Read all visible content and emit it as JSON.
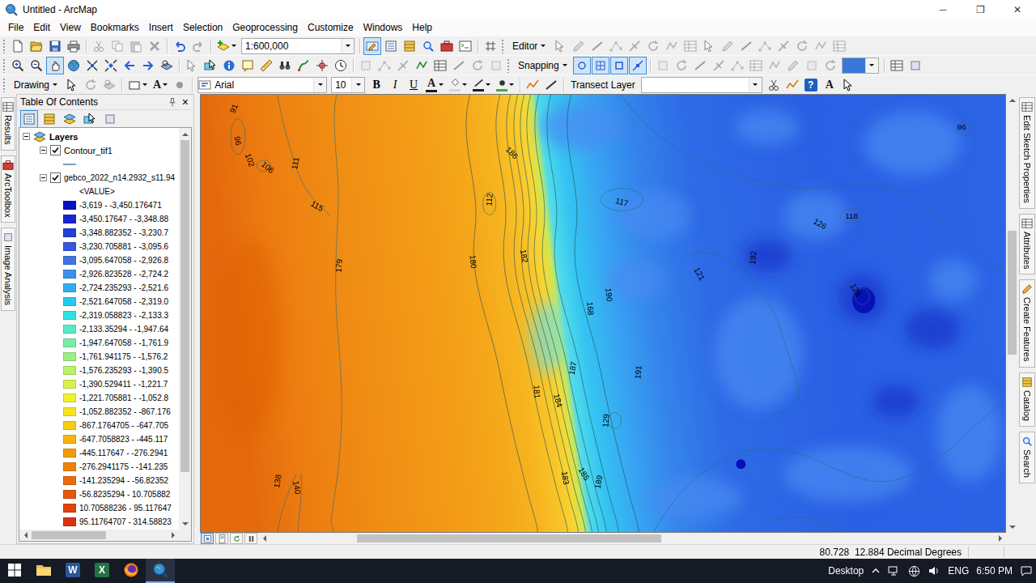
{
  "window": {
    "title": "Untitled - ArcMap",
    "controls": [
      "─",
      "❐",
      "✕"
    ]
  },
  "menu": [
    "File",
    "Edit",
    "View",
    "Bookmarks",
    "Insert",
    "Selection",
    "Geoprocessing",
    "Customize",
    "Windows",
    "Help"
  ],
  "standard_toolbar": {
    "file": [
      {
        "disabled": false,
        "pressed": false
      },
      {
        "disabled": false,
        "pressed": false
      },
      {
        "disabled": false,
        "pressed": false
      },
      {
        "disabled": false,
        "pressed": false
      }
    ],
    "clipboard": [
      {
        "disabled": true,
        "pressed": false
      },
      {
        "disabled": true,
        "pressed": false
      },
      {
        "disabled": true,
        "pressed": false
      },
      {
        "disabled": true,
        "pressed": false
      }
    ],
    "history": [
      {
        "disabled": false,
        "pressed": false
      },
      {
        "disabled": true,
        "pressed": false
      }
    ],
    "add_data": [
      {
        "disabled": false,
        "pressed": false
      }
    ],
    "scale": "1:600,000",
    "windows": [
      {
        "disabled": false,
        "pressed": true
      },
      {
        "disabled": false,
        "pressed": false
      },
      {
        "disabled": false,
        "pressed": false
      },
      {
        "disabled": false,
        "pressed": false
      },
      {
        "disabled": false,
        "pressed": false
      },
      {
        "disabled": false,
        "pressed": false
      }
    ],
    "extras": [
      {
        "disabled": false,
        "pressed": false
      }
    ],
    "editor_menu": "Editor",
    "edit_tools": [
      {
        "disabled": true,
        "pressed": false
      },
      {
        "disabled": true,
        "pressed": false
      },
      {
        "disabled": true,
        "pressed": false
      },
      {
        "disabled": true,
        "pressed": false
      },
      {
        "disabled": true,
        "pressed": false
      },
      {
        "disabled": true,
        "pressed": false
      },
      {
        "disabled": true,
        "pressed": false
      },
      {
        "disabled": true,
        "pressed": false
      },
      {
        "disabled": true,
        "pressed": false
      },
      {
        "disabled": true,
        "pressed": false
      },
      {
        "disabled": true,
        "pressed": false
      },
      {
        "disabled": true,
        "pressed": false
      },
      {
        "disabled": true,
        "pressed": false
      },
      {
        "disabled": true,
        "pressed": false
      },
      {
        "disabled": true,
        "pressed": false
      },
      {
        "disabled": true,
        "pressed": false
      }
    ]
  },
  "tools_toolbar": {
    "navigation": [
      {
        "disabled": false,
        "pressed": false
      },
      {
        "disabled": false,
        "pressed": false
      },
      {
        "disabled": false,
        "pressed": true
      },
      {
        "disabled": false,
        "pressed": false
      },
      {
        "disabled": false,
        "pressed": false
      },
      {
        "disabled": false,
        "pressed": false
      },
      {
        "disabled": false,
        "pressed": false
      },
      {
        "disabled": false,
        "pressed": false
      },
      {
        "disabled": false,
        "pressed": false
      }
    ],
    "query": [
      {
        "disabled": true,
        "pressed": false
      },
      {
        "disabled": false,
        "pressed": false
      },
      {
        "disabled": false,
        "pressed": false
      },
      {
        "disabled": false,
        "pressed": false
      },
      {
        "disabled": false,
        "pressed": false
      },
      {
        "disabled": false,
        "pressed": false
      },
      {
        "disabled": false,
        "pressed": false
      },
      {
        "disabled": false,
        "pressed": false
      },
      {
        "disabled": false,
        "pressed": false
      }
    ],
    "analysis": [
      {
        "disabled": true,
        "pressed": false
      },
      {
        "disabled": true,
        "pressed": false
      },
      {
        "disabled": true,
        "pressed": false
      },
      {
        "disabled": false,
        "pressed": false
      },
      {
        "disabled": false,
        "pressed": false
      },
      {
        "disabled": true,
        "pressed": false
      },
      {
        "disabled": true,
        "pressed": false
      },
      {
        "disabled": true,
        "pressed": false
      }
    ],
    "snapping_menu": "Snapping",
    "snapping": [
      {
        "disabled": false,
        "pressed": true
      },
      {
        "disabled": false,
        "pressed": true
      },
      {
        "disabled": false,
        "pressed": true
      },
      {
        "disabled": false,
        "pressed": true
      }
    ],
    "georeferencing": [
      {
        "disabled": true,
        "pressed": false
      },
      {
        "disabled": true,
        "pressed": false
      },
      {
        "disabled": true,
        "pressed": false
      },
      {
        "disabled": true,
        "pressed": false
      },
      {
        "disabled": true,
        "pressed": false
      },
      {
        "disabled": true,
        "pressed": false
      },
      {
        "disabled": true,
        "pressed": false
      },
      {
        "disabled": true,
        "pressed": false
      },
      {
        "disabled": true,
        "pressed": false
      },
      {
        "disabled": true,
        "pressed": false
      }
    ],
    "georef_field": {
      "highlighted": true
    },
    "end": [
      {
        "disabled": false,
        "pressed": false
      },
      {
        "disabled": false,
        "pressed": false
      }
    ]
  },
  "drawing_toolbar": {
    "menu": "Drawing",
    "select": [
      {
        "disabled": false,
        "pressed": false
      },
      {
        "disabled": true,
        "pressed": false
      },
      {
        "disabled": true,
        "pressed": false
      }
    ],
    "shape": [
      {
        "disabled": false,
        "pressed": false
      }
    ],
    "text_tool": {
      "label": "A",
      "disabled": false,
      "pressed": false
    },
    "marker": [
      {
        "disabled": true,
        "pressed": false
      }
    ],
    "font": "Arial",
    "size": "10",
    "styles": [
      {
        "label": "B",
        "pressed": false
      },
      {
        "label": "I",
        "pressed": false
      },
      {
        "label": "U",
        "pressed": false
      }
    ],
    "colors": [
      {
        "kind": "text",
        "label": "A",
        "color": "#1a1a1a"
      },
      {
        "kind": "fill",
        "color": "#d6d6d6"
      },
      {
        "kind": "line",
        "color": "#202020"
      },
      {
        "kind": "marker",
        "color": "#3fae49"
      }
    ],
    "extras": [
      {
        "disabled": false,
        "pressed": false
      },
      {
        "disabled": false,
        "pressed": false
      }
    ],
    "transect_label": "Transect Layer",
    "tail": [
      {
        "disabled": false,
        "pressed": false
      },
      {
        "disabled": false,
        "pressed": false
      }
    ],
    "help": "?",
    "text_button": "A",
    "last": [
      {
        "disabled": false,
        "pressed": false
      }
    ]
  },
  "left_tabs": [
    "Results",
    "ArcToolbox",
    "Image Analysis"
  ],
  "right_tabs": [
    "Edit Sketch Properties",
    "Attributes",
    "Create Features",
    "Catalog",
    "Search"
  ],
  "toc": {
    "title": "Table Of Contents",
    "close": "×",
    "toolbar": [
      {
        "disabled": false,
        "pressed": true
      },
      {
        "disabled": false,
        "pressed": false
      },
      {
        "disabled": false,
        "pressed": false
      },
      {
        "disabled": false,
        "pressed": false
      },
      {
        "disabled": false,
        "pressed": false
      }
    ],
    "root": {
      "label": "Layers",
      "expanded": true
    },
    "contour_layer": {
      "label": "Contour_tif1",
      "checked": true,
      "expanded": true,
      "color": "#4f7fa8"
    },
    "raster_layer": {
      "label": "gebco_2022_n14.2932_s11.94",
      "checked": true,
      "expanded": true,
      "field": "<VALUE>",
      "classes": [
        {
          "label": "-3,619 - -3,450.176471",
          "color": "#0b0fc4"
        },
        {
          "label": "-3,450.17647 - -3,348.88",
          "color": "#1626d2"
        },
        {
          "label": "-3,348.882352 - -3,230.7",
          "color": "#2540d8"
        },
        {
          "label": "-3,230.705881 - -3,095.6",
          "color": "#3458dc"
        },
        {
          "label": "-3,095.647058 - -2,926.8",
          "color": "#3f74e2"
        },
        {
          "label": "-2,926.823528 - -2,724.2",
          "color": "#3c90e8"
        },
        {
          "label": "-2,724.235293 - -2,521.6",
          "color": "#32aeec"
        },
        {
          "label": "-2,521.647058 - -2,319.0",
          "color": "#26caf0"
        },
        {
          "label": "-2,319.058823 - -2,133.3",
          "color": "#2ee2e4"
        },
        {
          "label": "-2,133.35294 - -1,947.64",
          "color": "#56eac6"
        },
        {
          "label": "-1,947.647058 - -1,761.9",
          "color": "#7aeca6"
        },
        {
          "label": "-1,761.941175 - -1,576.2",
          "color": "#9cee86"
        },
        {
          "label": "-1,576.235293 - -1,390.5",
          "color": "#bcf066"
        },
        {
          "label": "-1,390.529411 - -1,221.7",
          "color": "#d8f04a"
        },
        {
          "label": "-1,221.705881 - -1,052.8",
          "color": "#eef030"
        },
        {
          "label": "-1,052.882352 - -867.176",
          "color": "#f8e41c"
        },
        {
          "label": "-867.1764705 - -647.705",
          "color": "#f8cc12"
        },
        {
          "label": "-647.7058823 - -445.117",
          "color": "#f6b40e"
        },
        {
          "label": "-445.117647 - -276.2941",
          "color": "#f29c0c"
        },
        {
          "label": "-276.2941175 - -141.235",
          "color": "#ee840c"
        },
        {
          "label": "-141.235294 - -56.82352",
          "color": "#ea6c0c"
        },
        {
          "label": "-56.8235294 - 10.705882",
          "color": "#e6560c"
        },
        {
          "label": "10.70588236 - 95.117647",
          "color": "#e2420e"
        },
        {
          "label": "95.11764707 - 314.58823",
          "color": "#d83412"
        }
      ]
    },
    "vscroll": {
      "level": 0,
      "thumb": 0.88
    },
    "hscroll": {
      "level": 0,
      "thumb": 0.55
    }
  },
  "map": {
    "contour_labels": [
      "91",
      "96",
      "102",
      "106",
      "111",
      "115",
      "179",
      "180",
      "182",
      "186",
      "112",
      "117",
      "126",
      "118",
      "121",
      "192",
      "190",
      "168",
      "191",
      "187",
      "181",
      "184",
      "129",
      "183",
      "185",
      "189",
      "138",
      "140",
      "96",
      "128"
    ],
    "vscroll": {
      "level": 0.3,
      "thumb": 0.3
    },
    "hscroll": {
      "level": 0.12,
      "thumb": 0.42
    },
    "view_buttons": [
      {
        "disabled": false,
        "pressed": true
      },
      {
        "disabled": false,
        "pressed": false
      }
    ],
    "refresh_buttons": [
      {
        "disabled": false,
        "pressed": false
      },
      {
        "disabled": false,
        "pressed": false
      }
    ]
  },
  "status": {
    "text": "80.728  12.884 Decimal Degrees"
  },
  "taskbar": {
    "apps": [
      {
        "kind": "explorer",
        "active": false
      },
      {
        "kind": "word",
        "letter": "W",
        "active": false
      },
      {
        "kind": "excel",
        "letter": "X",
        "active": false
      },
      {
        "kind": "firefox",
        "active": false
      },
      {
        "kind": "arcmap",
        "active": true
      }
    ],
    "desktop": "Desktop",
    "language": "ENG",
    "time": "6:50 PM"
  }
}
